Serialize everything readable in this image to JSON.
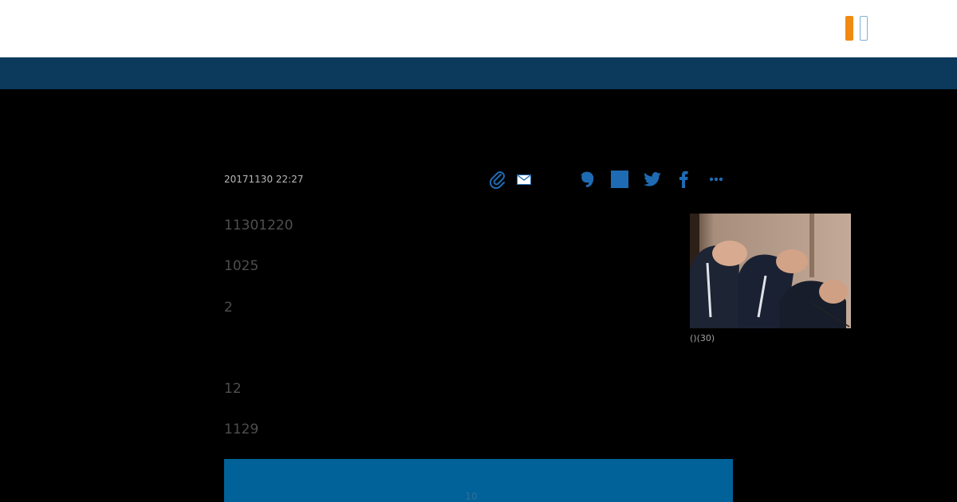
{
  "header": {
    "brand_colors": {
      "accent": "#f08a10",
      "outline": "#7fb2d6"
    },
    "nav_color": "#0b3a5c"
  },
  "article": {
    "date": "20171130 22:27",
    "paragraphs": [
      "11301220",
      "1025",
      "2",
      "12",
      "1129"
    ],
    "photo_caption": "()(30)"
  },
  "share_icons": [
    "clip-icon",
    "mail-icon",
    "evernote-icon",
    "hatena-icon",
    "twitter-icon",
    "facebook-icon",
    "more-icon"
  ],
  "banner": {
    "color": "#006298",
    "number": "10"
  }
}
